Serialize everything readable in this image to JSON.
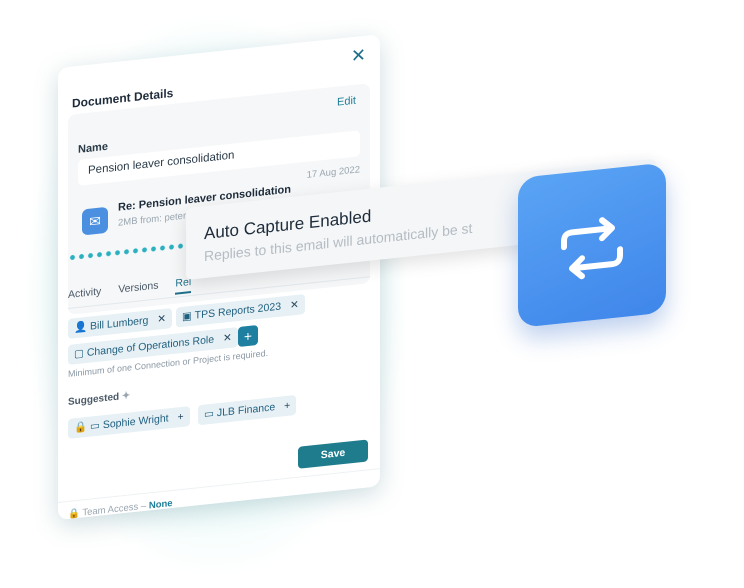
{
  "panel": {
    "close_label": "✕",
    "title": "Document Details",
    "edit_label": "Edit",
    "name_label": "Name",
    "name_value": "Pension leaver consolidation",
    "email": {
      "date": "17 Aug 2022",
      "subject": "Re: Pension leaver consolidation",
      "meta": "2MB from: peter.gibbons@innitech.com",
      "icon": "mail-icon"
    },
    "tabs": [
      {
        "label": "Activity"
      },
      {
        "label": "Versions"
      },
      {
        "label": "Rel"
      }
    ],
    "chips": [
      {
        "label": "Bill Lumberg",
        "icon": "person-icon"
      },
      {
        "label": "TPS Reports 2023",
        "icon": "folder-icon"
      },
      {
        "label": "Change of Operations Role",
        "icon": "chat-icon"
      }
    ],
    "add_label": "+",
    "hint": "Minimum of one Connection or Project is required.",
    "suggested_label": "Suggested",
    "suggested": [
      {
        "label": "Sophie Wright",
        "icon": "contact-card-icon"
      },
      {
        "label": "JLB Finance",
        "icon": "contact-card-icon"
      }
    ],
    "save_label": "Save",
    "footer_label": "Team Access –",
    "footer_value": "None"
  },
  "toast": {
    "title": "Auto Capture Enabled",
    "body": "Replies to this email will automatically be st"
  },
  "tile": {
    "icon": "sync-icon",
    "color": "#4a90ee"
  },
  "colors": {
    "accent": "#1f7f9a",
    "save": "#1e7c8c",
    "glow": "#78dcd7"
  }
}
